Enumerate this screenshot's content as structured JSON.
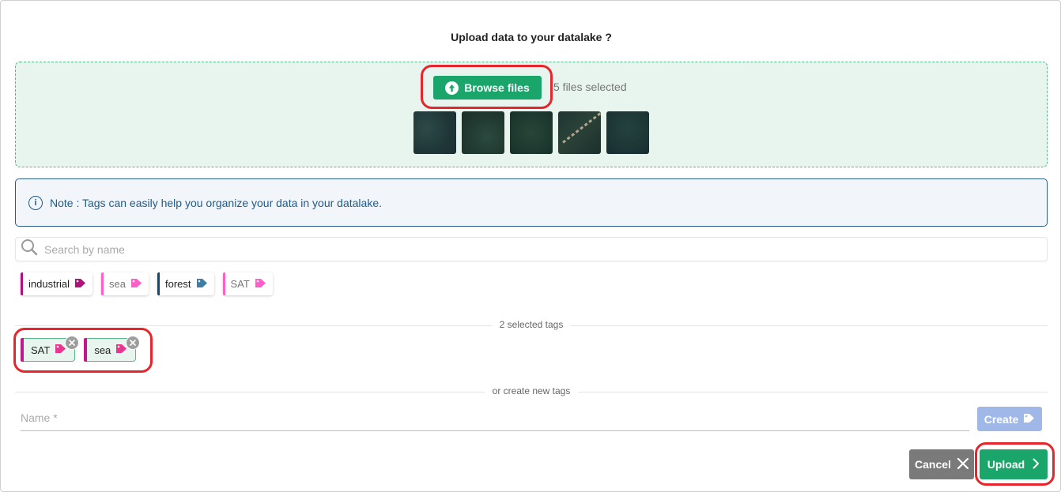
{
  "dialog": {
    "title": "Upload data to your datalake ?"
  },
  "dropzone": {
    "browse_label": "Browse files",
    "files_selected": "5 files selected",
    "thumbnails": [
      "image-1",
      "image-2",
      "image-3",
      "image-4",
      "image-5"
    ]
  },
  "note": {
    "text": "Note : Tags can easily help you organize your data in your datalake."
  },
  "search": {
    "placeholder": "Search by name",
    "value": ""
  },
  "tags": [
    {
      "label": "industrial",
      "color": "#b0127a",
      "icon_color": "#b0127a",
      "muted": false
    },
    {
      "label": "sea",
      "color": "#ff5fc8",
      "icon_color": "#ff5fc8",
      "muted": true
    },
    {
      "label": "forest",
      "color": "#0f4a6e",
      "icon_color": "#3d7ea6",
      "muted": false
    },
    {
      "label": "SAT",
      "color": "#ff5fc8",
      "icon_color": "#ff5fc8",
      "muted": true
    }
  ],
  "selected_section": {
    "label": "2 selected tags",
    "tags": [
      {
        "label": "SAT",
        "icon_color": "#e8358f"
      },
      {
        "label": "sea",
        "icon_color": "#e8358f"
      }
    ]
  },
  "create_section": {
    "label": "or create new tags",
    "name_placeholder": "Name *",
    "name_value": "",
    "create_label": "Create"
  },
  "actions": {
    "cancel_label": "Cancel",
    "upload_label": "Upload"
  },
  "colors": {
    "primary": "#1aa56a",
    "highlight": "#e8242c",
    "note_blue": "#1f5a8a",
    "create_disabled": "#9fb8e8",
    "cancel_gray": "#7a7a7a"
  }
}
